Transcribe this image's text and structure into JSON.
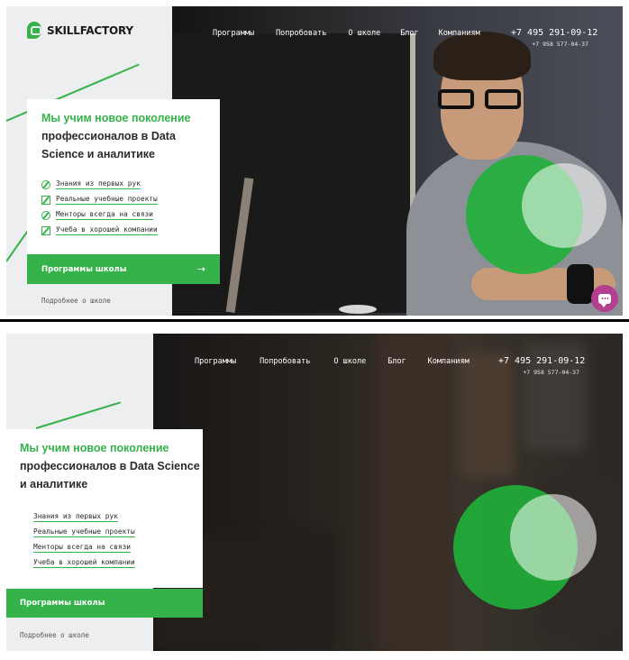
{
  "brand": {
    "logo_text": "SKILLFACTORY"
  },
  "nav": [
    "Программы",
    "Попробовать",
    "О школе",
    "Блог",
    "Компаниям"
  ],
  "phones": {
    "main": "+7 495 291-09-12",
    "secondary": "+7 958 577-04-37"
  },
  "hero": {
    "headline_green": "Мы учим новое поколение",
    "headline_rest": "профессионалов в Data Science и аналитике",
    "features": [
      "Знания из первых рук",
      "Реальные учебные проекты",
      "Менторы всегда на связи",
      "Учеба в хорошей компании"
    ],
    "cta_label": "Программы школы",
    "cta_arrow": "→",
    "more_link": "Подробнее о школе"
  },
  "colors": {
    "accent": "#35b24a",
    "chat": "#b43e8f"
  }
}
